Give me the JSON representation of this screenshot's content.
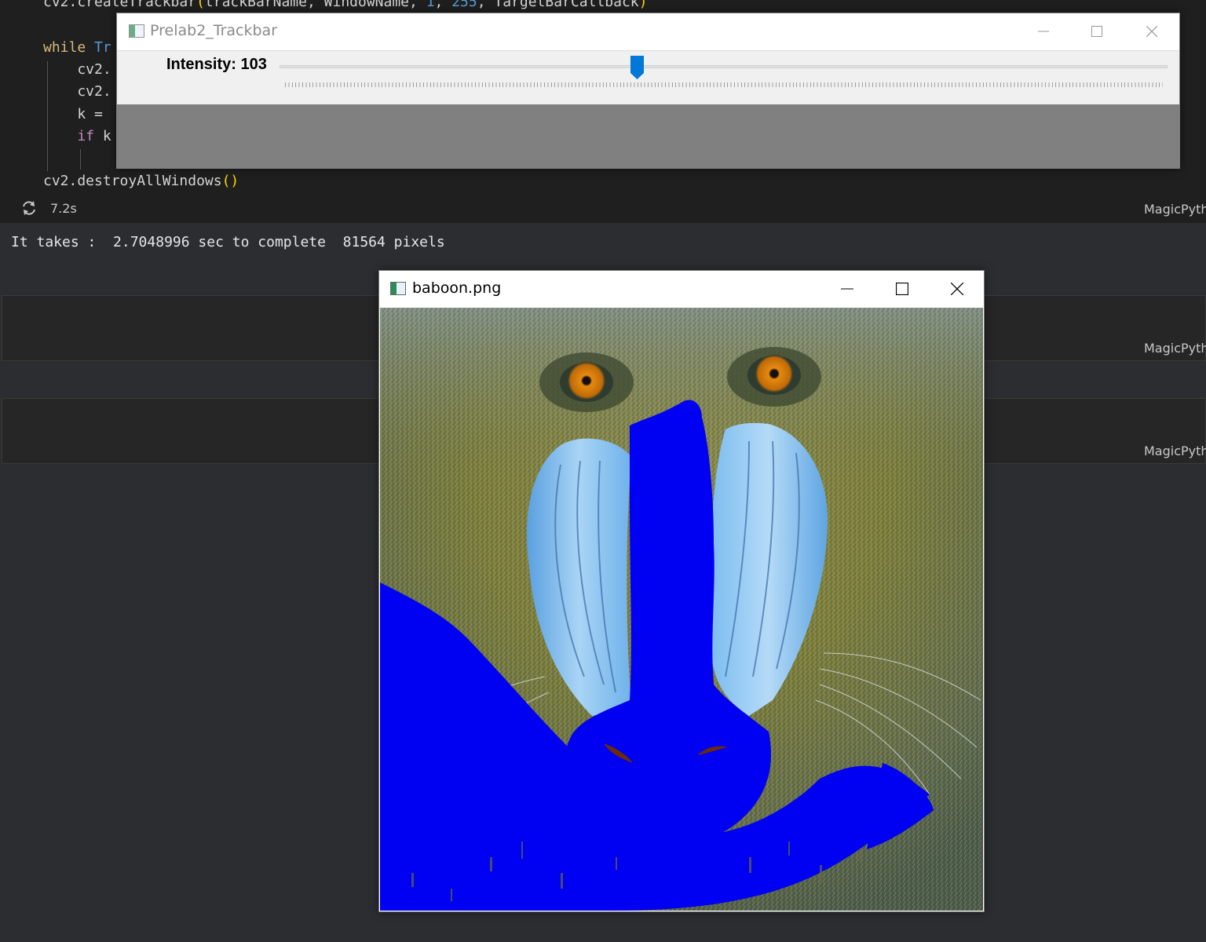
{
  "notebook": {
    "code_lines": [
      {
        "parts": [
          {
            "t": "cv2.createTrackbar",
            "c": "fn"
          },
          {
            "t": "(",
            "c": "par"
          },
          {
            "t": "trackBarName, WindowName, ",
            "c": ""
          },
          {
            "t": "1",
            "c": "num"
          },
          {
            "t": ", ",
            "c": ""
          },
          {
            "t": "255",
            "c": "num"
          },
          {
            "t": ", TargetBarCallback",
            "c": ""
          },
          {
            "t": ")",
            "c": "par"
          }
        ]
      },
      {
        "parts": []
      },
      {
        "parts": [
          {
            "t": "while ",
            "c": "kw2"
          },
          {
            "t": "Tr",
            "c": "kwb"
          }
        ]
      },
      {
        "parts": [
          {
            "t": "    cv2.",
            "c": ""
          }
        ]
      },
      {
        "parts": [
          {
            "t": "    cv2.",
            "c": ""
          }
        ]
      },
      {
        "parts": [
          {
            "t": "    k = ",
            "c": ""
          }
        ]
      },
      {
        "parts": [
          {
            "t": "    if ",
            "c": "kw"
          },
          {
            "t": "k",
            "c": ""
          }
        ]
      },
      {
        "parts": []
      },
      {
        "parts": [
          {
            "t": "cv2.destroyAllWindows",
            "c": ""
          },
          {
            "t": "()",
            "c": "par"
          }
        ]
      }
    ],
    "exec_time": "7.2s",
    "language_labels": [
      "MagicPyth",
      "MagicPyth",
      "MagicPyth"
    ],
    "output_text": "It takes :  2.7048996 sec to complete  81564 pixels"
  },
  "trackbar_window": {
    "title": "Prelab2_Trackbar",
    "trackbar_label": "Intensity: 103",
    "value": 103,
    "min": 1,
    "max": 255
  },
  "image_window": {
    "title": "baboon.png"
  },
  "colors": {
    "mask_blue": "#0000f2",
    "editor_bg": "#1f1f1f",
    "panel_bg": "#f0f0f0",
    "thumb": "#0078d7"
  },
  "icons": [
    "refresh-icon",
    "app-window-icon",
    "minimize-icon",
    "maximize-icon",
    "close-icon"
  ]
}
